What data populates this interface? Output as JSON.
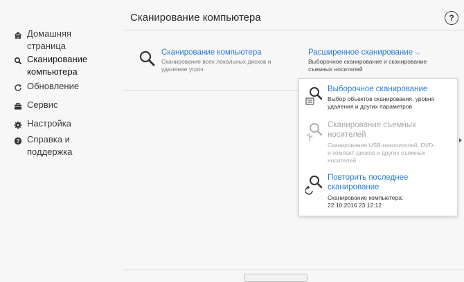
{
  "sidebar": {
    "items": [
      {
        "label": "Домашняя страница",
        "icon": "home-icon"
      },
      {
        "label": "Сканирование компьютера",
        "icon": "search-icon",
        "active": true
      },
      {
        "label": "Обновление",
        "icon": "refresh-icon"
      },
      {
        "label": "Сервис",
        "icon": "briefcase-icon"
      },
      {
        "label": "Настройка",
        "icon": "gear-icon"
      },
      {
        "label": "Справка и поддержка",
        "icon": "help-circle-icon"
      }
    ]
  },
  "header": {
    "title": "Сканирование компьютера",
    "help_label": "?"
  },
  "scan": {
    "title": "Сканирование компьютера",
    "desc_line1": "Сканирование всех локальных дисков и",
    "desc_line2": "удаление угроз"
  },
  "advanced": {
    "title": "Расширенное сканирование",
    "chevron": "⌵",
    "desc_line1": "Выборочное сканирование и сканирование",
    "desc_line2": "съемных носителей"
  },
  "dropdown": {
    "items": [
      {
        "title": "Выборочное сканирование",
        "sub_line1": "Выбор объектов сканирования, уровня",
        "sub_line2": "удаления и других параметров",
        "enabled": true
      },
      {
        "title_line1": "Сканирование съемных",
        "title_line2": "носителей",
        "sub_line1": "Сканирование USB-накопителей, DVD-",
        "sub_line2": "и компакт-дисков и других съемных",
        "sub_line3": "носителей",
        "enabled": false
      },
      {
        "title_line1": "Повторить последнее",
        "title_line2": "сканирование",
        "sub_line1": "Сканирование компьютера:",
        "sub_line2": "22.10.2016 23:12:12",
        "enabled": true
      }
    ]
  },
  "colors": {
    "accent": "#2a7bd0",
    "disabled": "#a8a8a8",
    "brand": "#3aa58a"
  }
}
